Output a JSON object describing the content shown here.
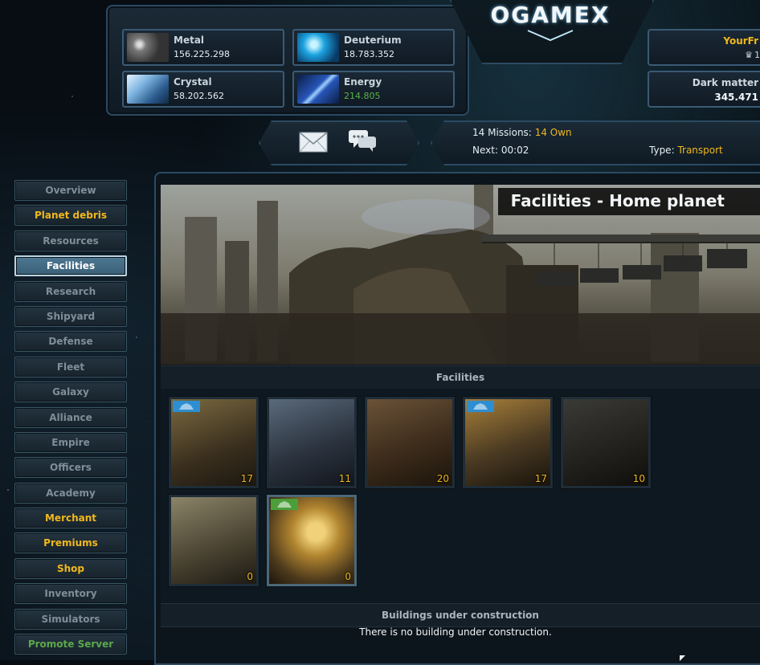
{
  "resources": [
    {
      "name": "Metal",
      "value": "156.225.298",
      "icon": "metal-icon"
    },
    {
      "name": "Deuterium",
      "value": "18.783.352",
      "icon": "deuterium-icon"
    },
    {
      "name": "Crystal",
      "value": "58.202.562",
      "icon": "crystal-icon"
    },
    {
      "name": "Energy",
      "value": "214.805",
      "icon": "energy-icon",
      "value_color": "#58b24a"
    }
  ],
  "logo": "OGAMEX",
  "player": {
    "name": "YourFr",
    "rank": "1"
  },
  "dark_matter": {
    "label": "Dark matter",
    "value": "345.471"
  },
  "fleet": {
    "missions_label": "14 Missions:",
    "own_label": "14 Own",
    "next_label": "Next:",
    "next_value": "00:02",
    "type_label": "Type:",
    "type_value": "Transport"
  },
  "menu": [
    {
      "label": "Overview",
      "style": "normal"
    },
    {
      "label": "Planet debris",
      "style": "gold"
    },
    {
      "label": "Resources",
      "style": "normal"
    },
    {
      "label": "Facilities",
      "style": "active"
    },
    {
      "label": "Research",
      "style": "normal"
    },
    {
      "label": "Shipyard",
      "style": "normal"
    },
    {
      "label": "Defense",
      "style": "normal"
    },
    {
      "label": "Fleet",
      "style": "normal"
    },
    {
      "label": "Galaxy",
      "style": "normal"
    },
    {
      "label": "Alliance",
      "style": "normal"
    },
    {
      "label": "Empire",
      "style": "normal"
    },
    {
      "label": "Officers",
      "style": "normal"
    },
    {
      "label": "Academy",
      "style": "normal"
    },
    {
      "label": "Merchant",
      "style": "gold"
    },
    {
      "label": "Premiums",
      "style": "gold"
    },
    {
      "label": "Shop",
      "style": "gold"
    },
    {
      "label": "Inventory",
      "style": "normal"
    },
    {
      "label": "Simulators",
      "style": "normal"
    },
    {
      "label": "Promote Server",
      "style": "green"
    }
  ],
  "page": {
    "banner_title": "Facilities - Home planet",
    "facilities_header": "Facilities",
    "construction_header": "Buildings under construction",
    "no_construction": "There is no building under construction."
  },
  "buildings": [
    {
      "level": "17",
      "flag": "blue"
    },
    {
      "level": "11",
      "flag": ""
    },
    {
      "level": "20",
      "flag": ""
    },
    {
      "level": "17",
      "flag": "blue"
    },
    {
      "level": "10",
      "flag": ""
    },
    {
      "level": "0",
      "flag": ""
    },
    {
      "level": "0",
      "flag": "green"
    }
  ],
  "colors": {
    "accent": "#f1b81c",
    "energy": "#58b24a",
    "active_menu": "#4d7791"
  }
}
